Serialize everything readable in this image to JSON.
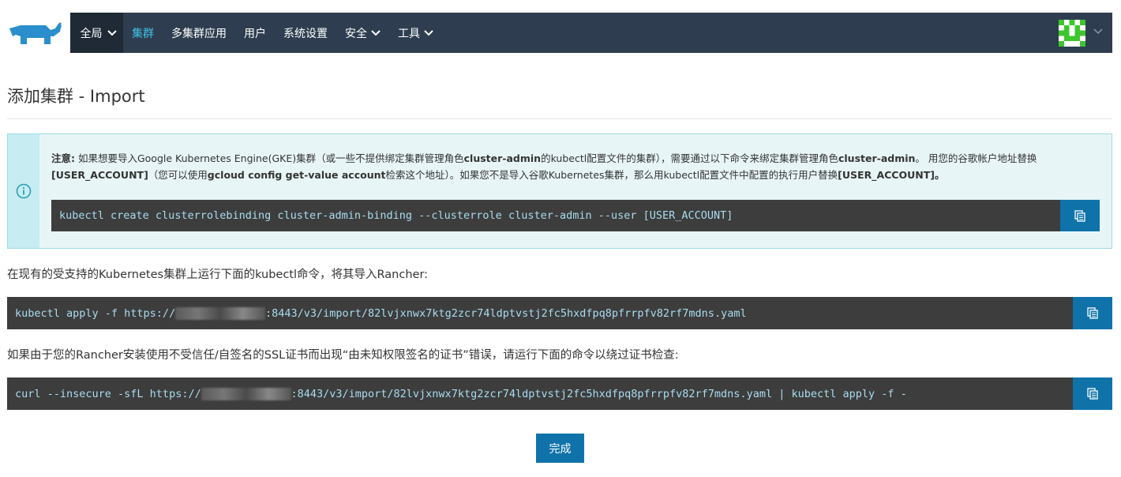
{
  "nav": {
    "global": "全局",
    "items": [
      "集群",
      "多集群应用",
      "用户",
      "系统设置",
      "安全",
      "工具"
    ]
  },
  "page": {
    "title": "添加集群 - Import"
  },
  "notice": {
    "label": "注意:",
    "t1": " 如果想要导入Google Kubernetes Engine(GKE)集群（或一些不提供绑定集群管理角色",
    "b1": "cluster-admin",
    "t2": "的kubectl配置文件的集群），需要通过以下命令来绑定集群管理角色",
    "b2": "cluster-admin",
    "t3": "。 用您的谷歌帐户地址替换",
    "b3": "[USER_ACCOUNT]",
    "t4": "（您可以使用",
    "b4": "gcloud config get-value account",
    "t5": "检索这个地址）。如果您不是导入谷歌Kubernetes集群，那么用kubectl配置文件中配置的执行用户替换",
    "b5": "[USER_ACCOUNT]。",
    "command": "kubectl create clusterrolebinding cluster-admin-binding --clusterrole cluster-admin --user [USER_ACCOUNT]"
  },
  "import": {
    "instruction": "在现有的受支持的Kubernetes集群上运行下面的kubectl命令，将其导入Rancher:",
    "cmd_prefix": "kubectl apply -f https://",
    "cmd_suffix": ":8443/v3/import/82lvjxnwx7ktg2zcr74ldptvstj2fc5hxdfpq8pfrrpfv82rf7mdns.yaml"
  },
  "insecure": {
    "instruction": "如果由于您的Rancher安装使用不受信任/自签名的SSL证书而出现“由未知权限签名的证书”错误，请运行下面的命令以绕过证书检查:",
    "cmd_prefix": "curl --insecure -sfL https://",
    "cmd_suffix": ":8443/v3/import/82lvjxnwx7ktg2zcr74ldptvstj2fc5hxdfpq8pfrrpfv82rf7mdns.yaml | kubectl apply -f -"
  },
  "actions": {
    "done": "完成"
  },
  "colors": {
    "nav_bg": "#2e3e50",
    "accent": "#0f73aa",
    "active_nav": "#3ec1e6",
    "code_bg": "#3d3d3d"
  }
}
